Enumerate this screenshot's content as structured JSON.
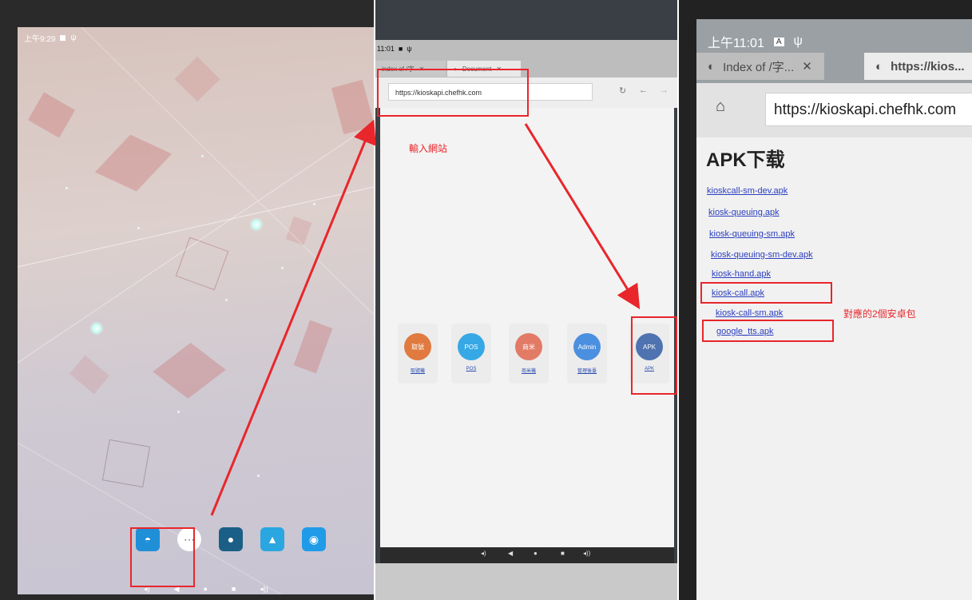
{
  "panel1": {
    "status_time": "上午9:29",
    "dock_icons": [
      "browser-icon",
      "app-drawer-icon",
      "camera-round-icon",
      "gallery-icon",
      "camera-icon"
    ]
  },
  "panel2": {
    "status_time": "11:01",
    "tabs": [
      {
        "label": "index of /字"
      },
      {
        "label": "Document"
      }
    ],
    "url": "https://kioskapi.chefhk.com",
    "annotation": "輸入網站",
    "cards": [
      {
        "circle": "取號",
        "label": "取號機",
        "color": "#e07a3f"
      },
      {
        "circle": "POS",
        "label": "POS",
        "color": "#36a8e6"
      },
      {
        "circle": "商米",
        "label": "商米機",
        "color": "#e27a66"
      },
      {
        "circle": "Admin",
        "label": "管理後臺",
        "color": "#4b8fe0"
      },
      {
        "circle": "APK",
        "label": "APK",
        "color": "#4f73b0"
      }
    ]
  },
  "panel3": {
    "status_time": "上午11:01",
    "tabs": [
      {
        "label": "Index of /字..."
      },
      {
        "label": "https://kios..."
      }
    ],
    "url": "https://kioskapi.chefhk.com",
    "heading": "APK下载",
    "apk_links": [
      "kioskcall-sm-dev.apk",
      "kiosk-queuing.apk",
      "kiosk-queuing-sm.apk",
      "kiosk-queuing-sm-dev.apk",
      "kiosk-hand.apk",
      "kiosk-call.apk",
      "kiosk-call-sm.apk",
      "google_tts.apk"
    ],
    "annotation": "對應的2個安卓包"
  },
  "colors": {
    "annotation_red": "#e8262b",
    "link_blue": "#2b3fbf"
  }
}
